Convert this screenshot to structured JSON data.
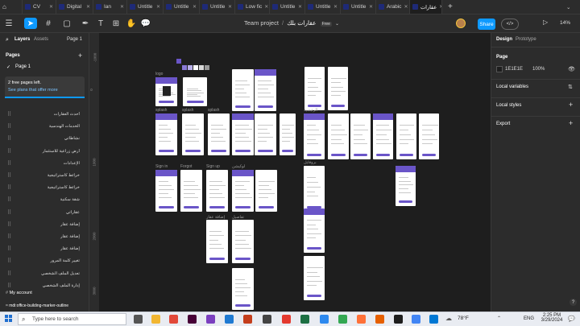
{
  "tabs": [
    {
      "label": "CV"
    },
    {
      "label": "Digital"
    },
    {
      "label": "Ian"
    },
    {
      "label": "Untitle"
    },
    {
      "label": "Untitle"
    },
    {
      "label": "Untitle"
    },
    {
      "label": "Low fic"
    },
    {
      "label": "Untitle"
    },
    {
      "label": "Untitle"
    },
    {
      "label": "Untitle"
    },
    {
      "label": "Arabic"
    },
    {
      "label": "عقارات"
    }
  ],
  "toolbar": {
    "project": "Team project",
    "separator": "/",
    "file_name": "عقارات بلك",
    "plan_badge": "Free",
    "share_label": "Share",
    "zoom": "14%"
  },
  "left_panel": {
    "tab_layers": "Layers",
    "tab_assets": "Assets",
    "page_selector": "Page 1",
    "pages_title": "Pages",
    "current_page": "Page 1",
    "notice_title": "2 free pages left.",
    "notice_link": "See plans that offer more",
    "layers": [
      "أحدث العقارات",
      "الخدمات الهندسية",
      "نشاطاتي",
      "أرض زراعية للاستثمار",
      "الإعدادات",
      "خرائط كاستراتيجية",
      "خرائط كاستراتيجية",
      "شقة سكنية",
      "عقاراتي",
      "إضافة عقار",
      "إضافة عقار",
      "إضافة عقار",
      "تغيير كلمة المرور",
      "تعديل الملف الشخصي",
      "إدارة الملف الشخصي"
    ],
    "section_account": "My account",
    "last_layer": "mdi:office-building-marker-outline"
  },
  "right_panel": {
    "tab_design": "Design",
    "tab_prototype": "Prototype",
    "page_section": "Page",
    "bg_hex": "1E1E1E",
    "bg_opacity": "100%",
    "local_variables": "Local variables",
    "local_styles": "Local styles",
    "export": "Export"
  },
  "canvas": {
    "ruler_marks": [
      "-1000",
      "0",
      "1000",
      "2000",
      "3000"
    ],
    "frame_labels": [
      "logo",
      "splash",
      "splash",
      "splash",
      "Sign in",
      "Forgot",
      "Sign up",
      "لوكيشن",
      "الرئيسية",
      "بروفايل",
      "إضافة عقار",
      "تفاصيل"
    ]
  },
  "taskbar": {
    "search_placeholder": "Type here to search",
    "weather": "78°F",
    "language": "ENG",
    "time": "2:25 PM",
    "date": "3/29/2024"
  },
  "colors": {
    "accent": "#0d99ff",
    "brand_purple": "#6a55c8",
    "panel_bg": "#2c2c2c",
    "canvas_bg": "#1e1e1e"
  }
}
